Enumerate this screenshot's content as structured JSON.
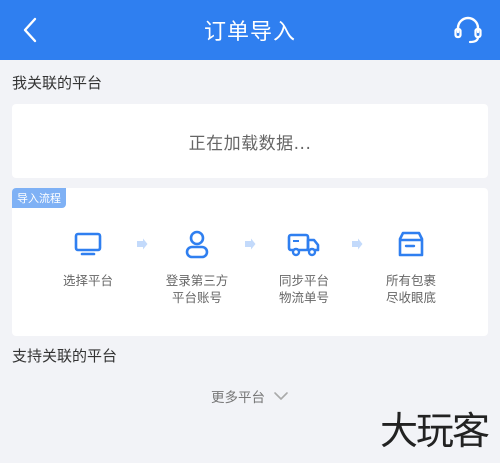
{
  "header": {
    "title": "订单导入",
    "back_icon": "chevron-left-icon",
    "support_icon": "headset-icon"
  },
  "linked": {
    "title": "我关联的平台",
    "loading": "正在加载数据..."
  },
  "flow": {
    "badge": "导入流程",
    "steps": [
      {
        "icon": "monitor-icon",
        "label": "选择平台"
      },
      {
        "icon": "user-icon",
        "label": "登录第三方\n平台账号"
      },
      {
        "icon": "truck-icon",
        "label": "同步平台\n物流单号"
      },
      {
        "icon": "box-icon",
        "label": "所有包裹\n尽收眼底"
      }
    ]
  },
  "supported": {
    "title": "支持关联的平台",
    "more_label": "更多平台"
  },
  "watermark": "大玩客",
  "colors": {
    "primary": "#2f7ff0",
    "background": "#f2f3f7",
    "badge": "#7fb1f5"
  }
}
